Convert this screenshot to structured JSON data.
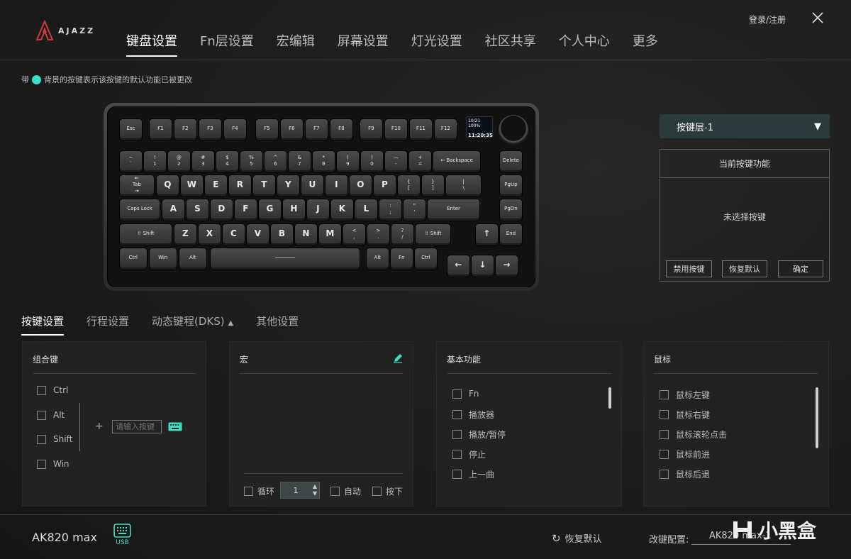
{
  "header": {
    "brand": "AJAZZ",
    "login": "登录/注册",
    "nav": [
      "键盘设置",
      "Fn层设置",
      "宏编辑",
      "屏幕设置",
      "灯光设置",
      "社区共享",
      "个人中心",
      "更多"
    ]
  },
  "hint": {
    "prefix": "带",
    "text": "背景的按键表示该按键的默认功能已被更改"
  },
  "keyboard": {
    "screen_line1": "10/21 100%",
    "screen_time": "11:20:35",
    "rows": [
      [
        "Esc",
        "F1",
        "F2",
        "F3",
        "F4",
        "F5",
        "F6",
        "F7",
        "F8",
        "F9",
        "F10",
        "F11",
        "F12"
      ],
      [
        "~\n`",
        "!\n1",
        "@\n2",
        "#\n3",
        "$\n4",
        "%\n5",
        "^\n6",
        "&\n7",
        "*\n8",
        "(\n9",
        ")\n0",
        "—\n-",
        "+\n=",
        "← Backspace",
        "Delete"
      ],
      [
        "⇤\nTab\n⇥",
        "Q",
        "W",
        "E",
        "R",
        "T",
        "Y",
        "U",
        "I",
        "O",
        "P",
        "{\n[",
        "}\n]",
        "|\n\\",
        "PgUp"
      ],
      [
        "Caps Lock",
        "A",
        "S",
        "D",
        "F",
        "G",
        "H",
        "J",
        "K",
        "L",
        ":\n;",
        "\"\n'",
        "Enter",
        "PgDn"
      ],
      [
        "⇧ Shift",
        "Z",
        "X",
        "C",
        "V",
        "B",
        "N",
        "M",
        "<\n,",
        ">\n.",
        "?\n/",
        "⇧ Shift",
        "↑",
        "End"
      ],
      [
        "Ctrl",
        "Win",
        "Alt",
        "",
        "Alt",
        "Fn",
        "Ctrl",
        "←",
        "↓",
        "→"
      ]
    ]
  },
  "right_panel": {
    "layer": "按键层-1",
    "func_title": "当前按键功能",
    "none_selected": "未选择按键",
    "buttons": [
      "禁用按键",
      "恢复默认",
      "确定"
    ]
  },
  "subtabs": [
    "按键设置",
    "行程设置",
    "动态键程(DKS)",
    "其他设置"
  ],
  "combo": {
    "title": "组合键",
    "keys": [
      "Ctrl",
      "Alt",
      "Shift",
      "Win"
    ],
    "placeholder": "请输入按键"
  },
  "macro": {
    "title": "宏",
    "loop": "循环",
    "count": "1",
    "auto": "自动",
    "press": "按下"
  },
  "basic": {
    "title": "基本功能",
    "items": [
      "Fn",
      "播放器",
      "播放/暂停",
      "停止",
      "上一曲"
    ]
  },
  "mouse": {
    "title": "鼠标",
    "items": [
      "鼠标左键",
      "鼠标右键",
      "鼠标滚轮点击",
      "鼠标前进",
      "鼠标后退"
    ]
  },
  "footer": {
    "device": "AK820 max",
    "conn": "USB",
    "restore": "恢复默认",
    "config_label": "改键配置:",
    "config_value": "AK820 max-1",
    "watermark": "小黑盒"
  },
  "colors": {
    "accent": "#3ce0c8",
    "brand_red": "#d23a3a",
    "layer_bg": "#2b3a3a"
  }
}
